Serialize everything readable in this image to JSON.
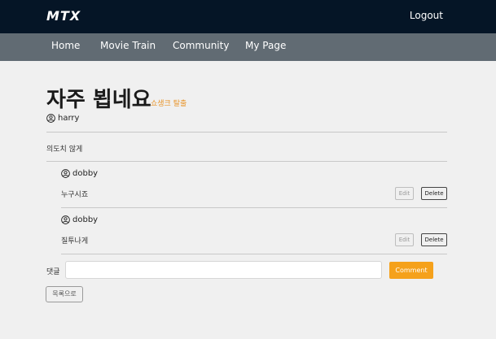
{
  "header": {
    "logo": "MTX",
    "logout_label": "Logout"
  },
  "nav": {
    "items": [
      {
        "label": "Home"
      },
      {
        "label": "Movie Train"
      },
      {
        "label": "Community"
      },
      {
        "label": "My Page"
      }
    ]
  },
  "post": {
    "title": "자주 뵙네요",
    "spoiler_tag": "쇼생크 탈출",
    "author": "harry",
    "author_icon": "user-circle-icon",
    "body": "의도치 않게"
  },
  "comments": [
    {
      "author": "dobby",
      "text": "누구시죠",
      "edit_label": "Edit",
      "delete_label": "Delete"
    },
    {
      "author": "dobby",
      "text": "질투나게",
      "edit_label": "Edit",
      "delete_label": "Delete"
    }
  ],
  "comment_form": {
    "label": "댓글",
    "value": "",
    "submit_label": "Comment"
  },
  "back_label": "목록으로",
  "colors": {
    "topbar": "#051526",
    "navbar": "#616b73",
    "accent": "#f5a11b",
    "spoiler": "#e8952b",
    "background": "#f0f0f0"
  }
}
